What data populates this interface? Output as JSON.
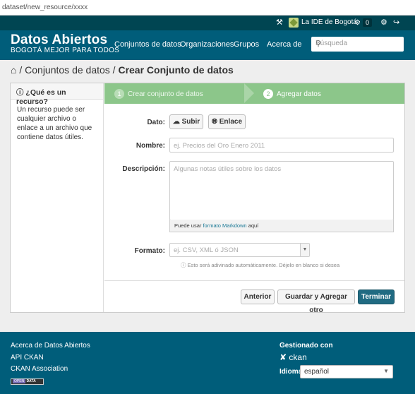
{
  "browser": {
    "url": "dataset/new_resource/xxxx"
  },
  "account": {
    "site_name": "La IDE de Bogotá",
    "count": "0"
  },
  "masthead": {
    "brand_title": "Datos Abiertos",
    "brand_subtitle": "BOGOTÁ MEJOR PARA TODOS",
    "nav": [
      "Conjuntos de datos",
      "Organizaciones",
      "Grupos",
      "Acerca de"
    ],
    "search_placeholder": "Búsqueda"
  },
  "breadcrumb": {
    "sep1": "/",
    "link": "Conjuntos de datos",
    "sep2": "/",
    "current": "Crear Conjunto de datos"
  },
  "sidebar": {
    "heading": "¿Qué es un recurso?",
    "body": "Un recurso puede ser cualquier archivo o enlace a un archivo que contiene datos útiles."
  },
  "stages": [
    {
      "num": "1",
      "label": "Crear conjunto de datos"
    },
    {
      "num": "2",
      "label": "Agregar datos"
    }
  ],
  "form": {
    "data_label": "Dato:",
    "upload_label": "Subir",
    "link_label": "Enlace",
    "name_label": "Nombre:",
    "name_placeholder": "ej. Precios del Oro Enero 2011",
    "desc_label": "Descripción:",
    "desc_placeholder": "Algunas notas útiles sobre los datos",
    "markdown_pre": "Puede usar",
    "markdown_link": "formato Markdown",
    "markdown_post": "aquí",
    "format_label": "Formato:",
    "format_placeholder": "ej. CSV, XML ó JSON",
    "format_hint": "Esto será adivinado automáticamente. Déjelo en blanco si desea"
  },
  "actions": {
    "previous": "Anterior",
    "save_add": "Guardar y Agregar otro",
    "finish": "Terminar"
  },
  "footer": {
    "links": [
      "Acerca de Datos Abiertos",
      "API CKAN",
      "CKAN Association"
    ],
    "opendata_badge_left": "OPEN",
    "opendata_badge_right": "DATA",
    "managed_by": "Gestionado con",
    "ckan": "ckan",
    "language_label": "Idioma:",
    "language_value": "español"
  },
  "colors": {
    "topbar": "#004552",
    "masthead": "#005d7a",
    "stage": "#8cc68a",
    "primary": "#206b82"
  }
}
